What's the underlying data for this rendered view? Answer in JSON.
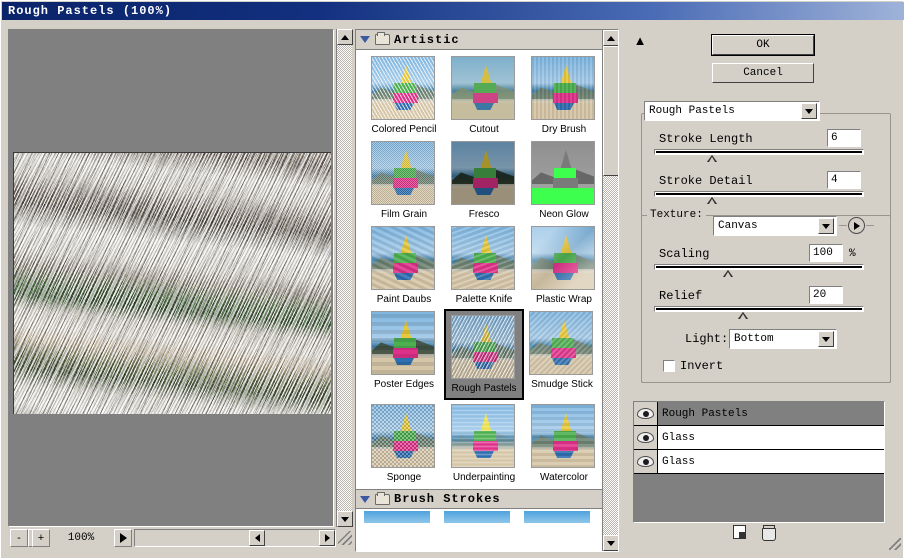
{
  "window": {
    "title": "Rough Pastels  (100%)"
  },
  "preview": {
    "zoom_label": "100%",
    "zoom_out_label": "-",
    "zoom_in_label": "+"
  },
  "gallery": {
    "categories": [
      {
        "name": "Artistic",
        "expanded": true,
        "filters": [
          {
            "label": "Colored Pencil",
            "variant": "v-colored-pencil",
            "selected": false
          },
          {
            "label": "Cutout",
            "variant": "v-cutout",
            "selected": false
          },
          {
            "label": "Dry Brush",
            "variant": "v-dry-brush",
            "selected": false
          },
          {
            "label": "Film Grain",
            "variant": "v-film-grain",
            "selected": false
          },
          {
            "label": "Fresco",
            "variant": "v-fresco",
            "selected": false
          },
          {
            "label": "Neon Glow",
            "variant": "v-neon-glow",
            "selected": false
          },
          {
            "label": "Paint Daubs",
            "variant": "v-paint-daubs",
            "selected": false
          },
          {
            "label": "Palette Knife",
            "variant": "v-palette-knife",
            "selected": false
          },
          {
            "label": "Plastic Wrap",
            "variant": "v-plastic-wrap",
            "selected": false
          },
          {
            "label": "Poster Edges",
            "variant": "v-poster-edges",
            "selected": false
          },
          {
            "label": "Rough Pastels",
            "variant": "v-rough-pastels",
            "selected": true
          },
          {
            "label": "Smudge Stick",
            "variant": "v-smudge-stick",
            "selected": false
          },
          {
            "label": "Sponge",
            "variant": "v-sponge",
            "selected": false
          },
          {
            "label": "Underpainting",
            "variant": "v-underpainting",
            "selected": false
          },
          {
            "label": "Watercolor",
            "variant": "v-watercolor",
            "selected": false
          }
        ]
      },
      {
        "name": "Brush Strokes",
        "expanded": true,
        "filters": []
      }
    ]
  },
  "buttons": {
    "ok": "OK",
    "cancel": "Cancel"
  },
  "settings": {
    "filter_name": "Rough Pastels",
    "stroke_length": {
      "label": "Stroke Length",
      "value": "6",
      "percent": 25
    },
    "stroke_detail": {
      "label": "Stroke Detail",
      "value": "4",
      "percent": 25
    },
    "texture": {
      "label": "Texture:",
      "value": "Canvas"
    },
    "scaling": {
      "label": "Scaling",
      "value": "100",
      "unit": "%",
      "percent": 33
    },
    "relief": {
      "label": "Relief",
      "value": "20",
      "percent": 40
    },
    "light": {
      "label": "Light:",
      "value": "Bottom"
    },
    "invert": {
      "label": "Invert",
      "checked": false
    }
  },
  "filter_stack": {
    "items": [
      {
        "label": "Rough Pastels",
        "visible": true,
        "selected": true
      },
      {
        "label": "Glass",
        "visible": true,
        "selected": false
      },
      {
        "label": "Glass",
        "visible": true,
        "selected": false
      }
    ]
  },
  "colors": {
    "face": "#d4d0c8",
    "title_start": "#0a246a",
    "preview_bg": "#808080",
    "selection": "#808080",
    "triangle": "#3b5aa0"
  }
}
